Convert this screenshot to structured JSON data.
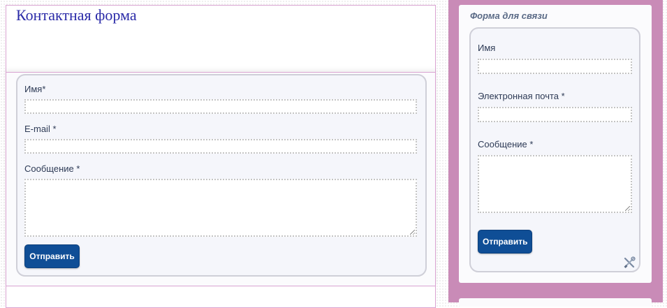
{
  "main": {
    "title": "Контактная форма",
    "form": {
      "name_label": "Имя*",
      "name_value": "",
      "email_label": "E-mail *",
      "email_value": "",
      "message_label": "Сообщение *",
      "message_value": "",
      "submit_label": "Отправить"
    }
  },
  "sidebar": {
    "widget_title": "Форма для связи",
    "form": {
      "name_label": "Имя",
      "name_value": "",
      "email_label": "Электронная почта *",
      "email_value": "",
      "message_label": "Сообщение *",
      "message_value": "",
      "submit_label": "Отправить"
    },
    "tools_icon": "wrench-screwdriver-icon"
  },
  "colors": {
    "title": "#2b2ba8",
    "button": "#0f4e96",
    "sidebar_bg": "#c98bb7",
    "panel_border": "#d9a3d1"
  }
}
